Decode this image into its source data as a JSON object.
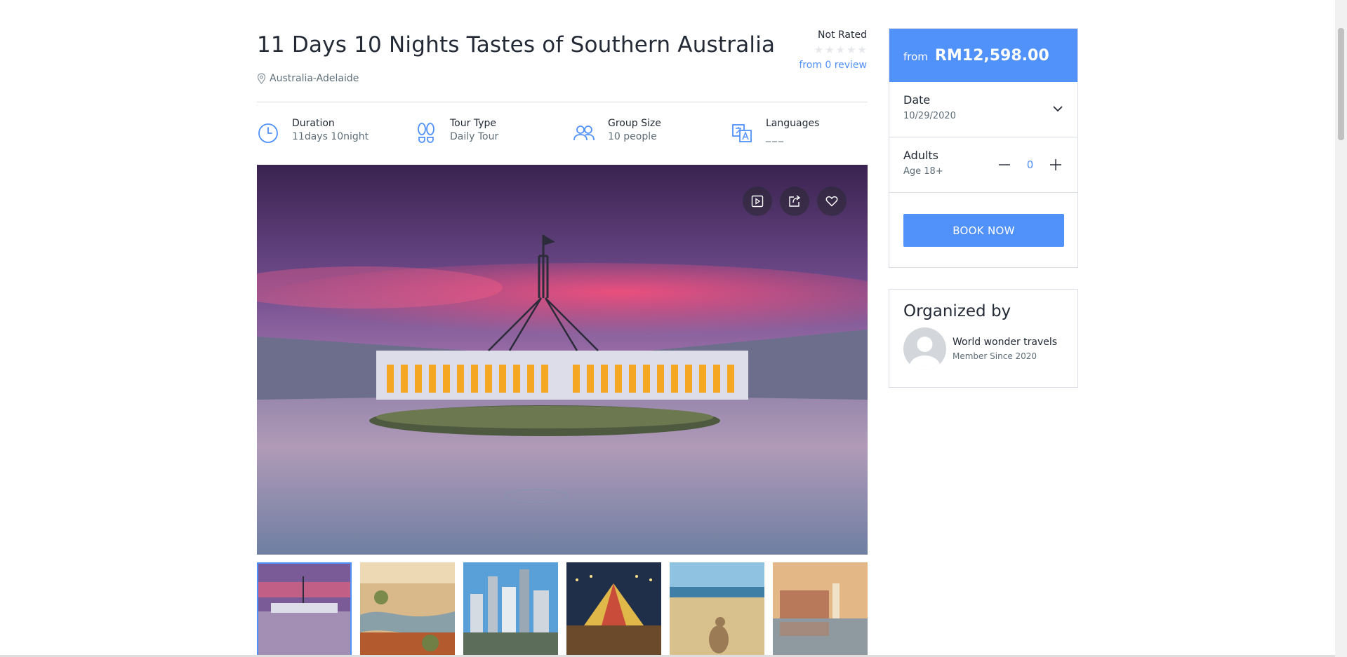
{
  "tour": {
    "title": "11 Days 10 Nights Tastes of Southern Australia",
    "location": "Australia-Adelaide",
    "rating_label": "Not Rated",
    "reviews_link": "from 0 review",
    "stars": 0
  },
  "info": [
    {
      "icon": "clock-icon",
      "label": "Duration",
      "value": "11days 10night"
    },
    {
      "icon": "footprints-icon",
      "label": "Tour Type",
      "value": "Daily Tour"
    },
    {
      "icon": "group-icon",
      "label": "Group Size",
      "value": "10 people"
    },
    {
      "icon": "languages-icon",
      "label": "Languages",
      "value": "___"
    }
  ],
  "hero_actions": [
    "video-icon",
    "share-icon",
    "heart-icon"
  ],
  "thumbnails": 6,
  "booking": {
    "from_label": "from",
    "price": "RM12,598.00",
    "date_label": "Date",
    "date_value": "10/29/2020",
    "adults_label": "Adults",
    "adults_sub": "Age 18+",
    "adults_count": "0",
    "book_label": "BOOK NOW"
  },
  "organizer": {
    "heading": "Organized by",
    "name": "World wonder travels",
    "since": "Member Since 2020"
  },
  "colors": {
    "accent": "#5191fa",
    "text": "#232a35",
    "muted": "#5e6d77",
    "border": "#dadde3"
  }
}
